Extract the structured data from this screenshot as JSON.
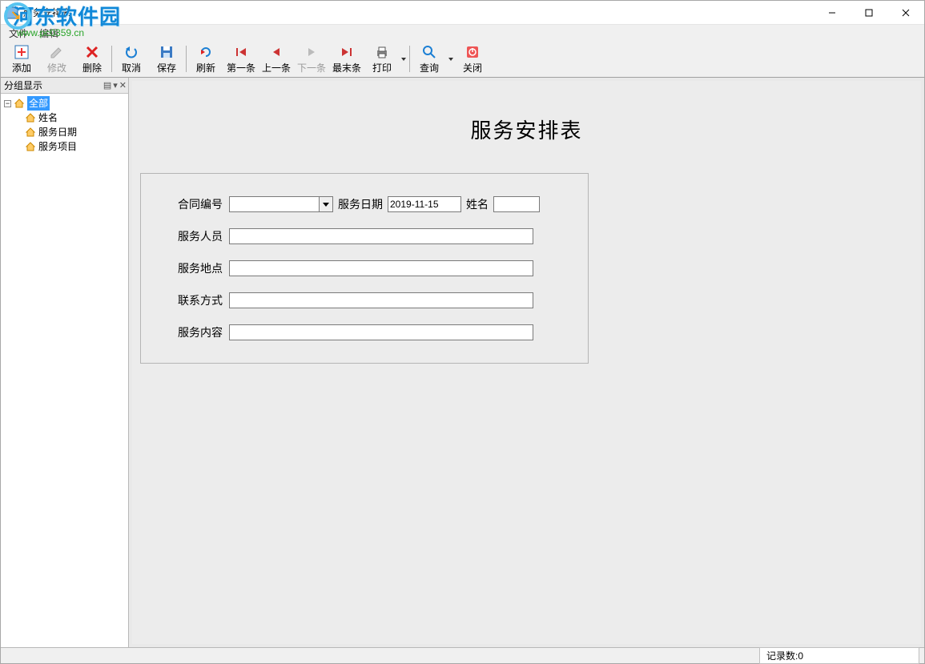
{
  "window": {
    "title": "服务安排表"
  },
  "menu": {
    "file": "文件",
    "edit": "编辑"
  },
  "toolbar": {
    "add": "添加",
    "modify": "修改",
    "delete": "删除",
    "cancel": "取消",
    "save": "保存",
    "refresh": "刷新",
    "first": "第一条",
    "prev": "上一条",
    "next": "下一条",
    "last": "最末条",
    "print": "打印",
    "query": "查询",
    "close": "关闭"
  },
  "side": {
    "title": "分组显示",
    "tree": {
      "root": "全部",
      "children": [
        "姓名",
        "服务日期",
        "服务项目"
      ]
    }
  },
  "form": {
    "title": "服务安排表",
    "labels": {
      "contract_no": "合同编号",
      "service_date": "服务日期",
      "name": "姓名",
      "staff": "服务人员",
      "location": "服务地点",
      "contact": "联系方式",
      "content": "服务内容"
    },
    "values": {
      "contract_no": "",
      "service_date": "2019-11-15",
      "name": "",
      "staff": "",
      "location": "",
      "contact": "",
      "content": ""
    }
  },
  "status": {
    "record_count_label": "记录数:0"
  },
  "watermark": {
    "brand": "河东软件园",
    "url": "www.pc0359.cn"
  }
}
